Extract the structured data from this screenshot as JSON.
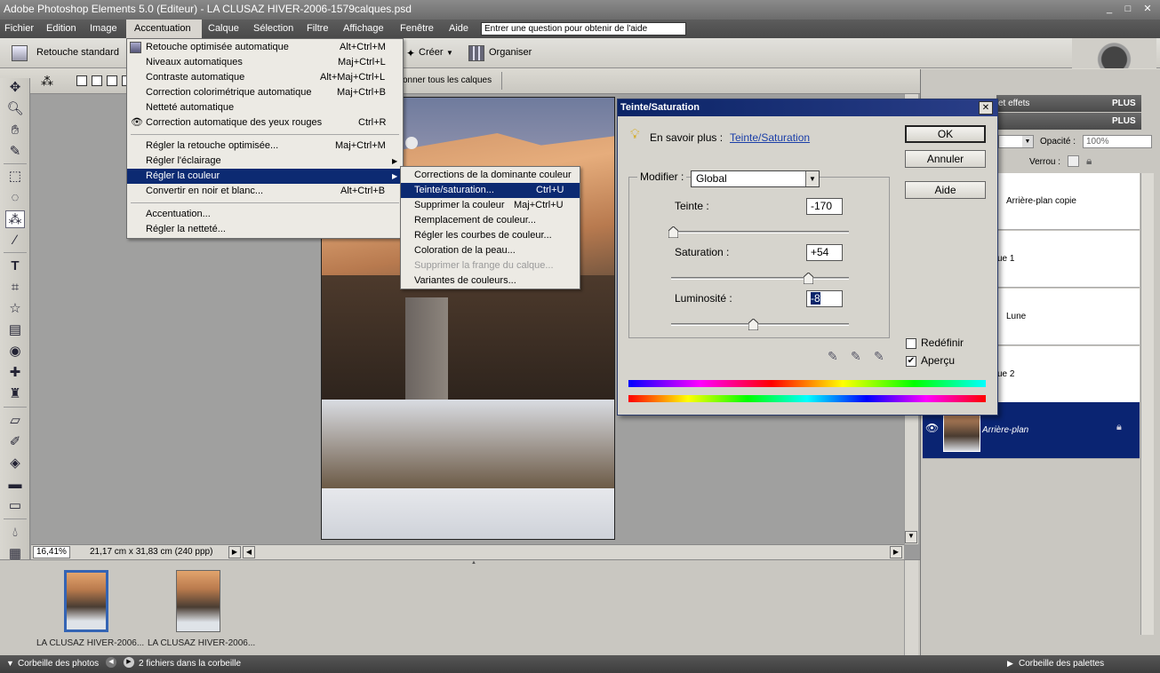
{
  "window": {
    "title": "Adobe Photoshop Elements 5.0 (Editeur) - LA CLUSAZ HIVER-2006-1579calques.psd",
    "controls": {
      "minimize": "_",
      "restore": "□",
      "close": "✕"
    }
  },
  "menubar": {
    "items": [
      "Fichier",
      "Edition",
      "Image",
      "Accentuation",
      "Calque",
      "Sélection",
      "Filtre",
      "Affichage",
      "Fenêtre",
      "Aide"
    ],
    "active": "Accentuation",
    "help_placeholder": "Entrer une question pour obtenir de l'aide"
  },
  "shortcuts": {
    "retouche_label": "Retouche standard",
    "creer_label": "Créer",
    "organiser_label": "Organiser"
  },
  "options_bar": {
    "text": "onner tous les calques"
  },
  "accentuation_menu": {
    "items": [
      {
        "label": "Retouche optimisée automatique",
        "shortcut": "Alt+Ctrl+M"
      },
      {
        "label": "Niveaux automatiques",
        "shortcut": "Maj+Ctrl+L"
      },
      {
        "label": "Contraste automatique",
        "shortcut": "Alt+Maj+Ctrl+L"
      },
      {
        "label": "Correction colorimétrique automatique",
        "shortcut": "Maj+Ctrl+B"
      },
      {
        "label": "Netteté automatique",
        "shortcut": ""
      },
      {
        "label": "Correction automatique des yeux rouges",
        "shortcut": "Ctrl+R"
      },
      {
        "label": "Régler la retouche optimisée...",
        "shortcut": "Maj+Ctrl+M"
      },
      {
        "label": "Régler l'éclairage",
        "shortcut": ""
      },
      {
        "label": "Régler la couleur",
        "shortcut": ""
      },
      {
        "label": "Convertir en noir et blanc...",
        "shortcut": "Alt+Ctrl+B"
      },
      {
        "label": "Accentuation...",
        "shortcut": ""
      },
      {
        "label": "Régler la netteté...",
        "shortcut": ""
      }
    ],
    "highlighted": "Régler la couleur"
  },
  "couleur_submenu": {
    "items": [
      {
        "label": "Corrections de la dominante couleur",
        "shortcut": ""
      },
      {
        "label": "Teinte/saturation...",
        "shortcut": "Ctrl+U"
      },
      {
        "label": "Supprimer la couleur",
        "shortcut": "Maj+Ctrl+U"
      },
      {
        "label": "Remplacement de couleur...",
        "shortcut": ""
      },
      {
        "label": "Régler les courbes de couleur...",
        "shortcut": ""
      },
      {
        "label": "Coloration de la peau...",
        "shortcut": ""
      },
      {
        "label": "Supprimer la frange du calque...",
        "shortcut": ""
      },
      {
        "label": "Variantes de couleurs...",
        "shortcut": ""
      }
    ],
    "highlighted": "Teinte/saturation...",
    "disabled": "Supprimer la frange du calque..."
  },
  "dialog": {
    "title": "Teinte/Saturation",
    "learn_more": "En savoir plus :",
    "learn_link": "Teinte/Saturation",
    "ok": "OK",
    "cancel": "Annuler",
    "help": "Aide",
    "modifier_label": "Modifier :",
    "modifier_value": "Global",
    "teinte_label": "Teinte :",
    "teinte_value": "-170",
    "saturation_label": "Saturation :",
    "saturation_value": "+54",
    "luminosite_label": "Luminosité :",
    "luminosite_value": "-8",
    "redefinir_label": "Redéfinir",
    "redefinir_checked": false,
    "apercu_label": "Aperçu",
    "apercu_checked": true,
    "slider_levels": {
      "teinte": 0.01,
      "saturation": 0.77,
      "luminosite": 0.46
    }
  },
  "palette": {
    "effets_header": "et effets",
    "plus1": "PLUS ▸",
    "plus2": "PLUS ▸",
    "opacite_label": "Opacité :",
    "opacite_value": "100%",
    "verrou_label": "Verrou :",
    "layers": [
      "Arrière-plan copie",
      "ue 1",
      "Lune",
      "ue 2",
      "Arrière-plan"
    ],
    "selected_layer": "Arrière-plan"
  },
  "status": {
    "zoom": "16,41%",
    "info": "21,17 cm x 31,83 cm (240 ppp)"
  },
  "photobin": {
    "thumbs": [
      "LA CLUSAZ HIVER-2006...",
      "LA CLUSAZ HIVER-2006..."
    ]
  },
  "bottombar": {
    "corbeille_photos": "Corbeille des photos",
    "count": "2 fichiers dans la corbeille",
    "corbeille_palettes": "Corbeille des palettes"
  }
}
